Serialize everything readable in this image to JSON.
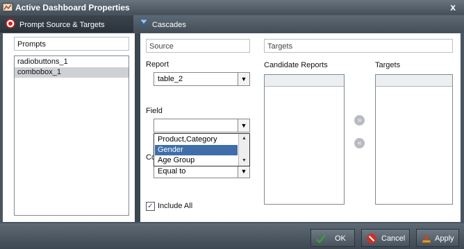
{
  "window": {
    "title": "Active Dashboard Properties",
    "close_glyph": "x"
  },
  "tabs": [
    {
      "label": "Prompt Source & Targets",
      "icon": "target-icon",
      "active": true
    },
    {
      "label": "Cascades",
      "icon": "cascade-icon",
      "active": false
    }
  ],
  "prompts": {
    "header": "Prompts",
    "items": [
      "radiobuttons_1",
      "combobox_1"
    ],
    "selected_index": 1
  },
  "source": {
    "header": "Source",
    "report_label": "Report",
    "report_value": "table_2",
    "field_label": "Field",
    "field_value": "",
    "field_options": [
      "Product,Category",
      "Gender",
      "Age Group"
    ],
    "field_highlighted": "Gender",
    "condition_label_partial": "Co",
    "condition_value": "Equal to",
    "include_all_label": "Include All",
    "include_all_checked": true
  },
  "targets": {
    "header": "Targets",
    "candidate_label": "Candidate Reports",
    "targets_label": "Targets",
    "add_glyph": "»",
    "remove_glyph": "«"
  },
  "buttons": {
    "ok": "OK",
    "cancel": "Cancel",
    "apply": "Apply"
  },
  "colors": {
    "chrome": "#4a5560",
    "selection": "#cdd0d4",
    "dropdown_highlight": "#3f6eaa",
    "ok_check": "#3aa03a",
    "cancel_red": "#c83228"
  }
}
